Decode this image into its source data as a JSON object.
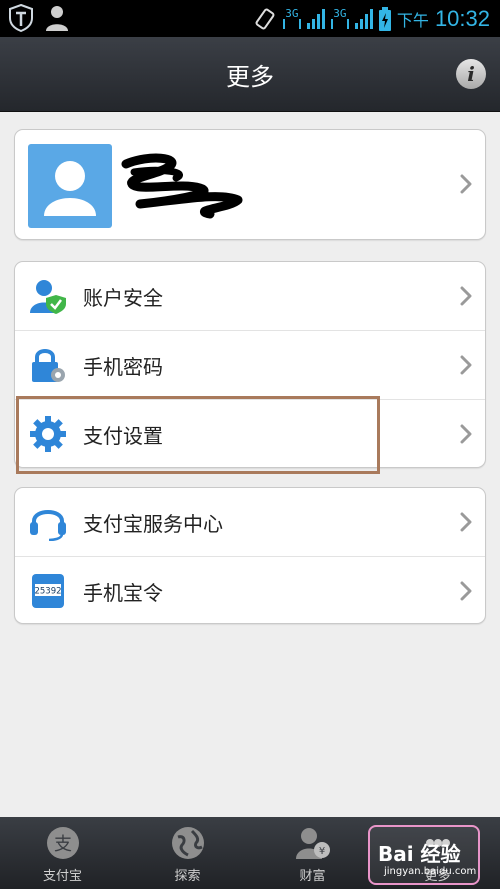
{
  "status_bar": {
    "net1": "3G",
    "net2": "3G",
    "ampm": "下午",
    "time": "10:32"
  },
  "header": {
    "title": "更多",
    "info_icon": "info-icon"
  },
  "account": {
    "avatar_icon": "user-avatar-icon"
  },
  "menu_group_1": [
    {
      "label": "账户安全",
      "icon": "user-shield-icon"
    },
    {
      "label": "手机密码",
      "icon": "lock-gear-icon"
    },
    {
      "label": "支付设置",
      "icon": "gear-icon"
    }
  ],
  "menu_group_2": [
    {
      "label": "支付宝服务中心",
      "icon": "headset-icon"
    },
    {
      "label": "手机宝令",
      "icon": "token-icon",
      "token_code": "25392"
    }
  ],
  "tabs": [
    {
      "label": "支付宝",
      "icon": "alipay-icon"
    },
    {
      "label": "探索",
      "icon": "globe-icon"
    },
    {
      "label": "财富",
      "icon": "wealth-icon"
    },
    {
      "label": "更多",
      "icon": "more-icon"
    }
  ],
  "watermark": {
    "text": "Bai 经验",
    "sub": "jingyan.baidu.com"
  },
  "colors": {
    "accent": "#33b5e5",
    "highlight_border": "#a97a5c",
    "watermark_border": "#e995c9"
  }
}
